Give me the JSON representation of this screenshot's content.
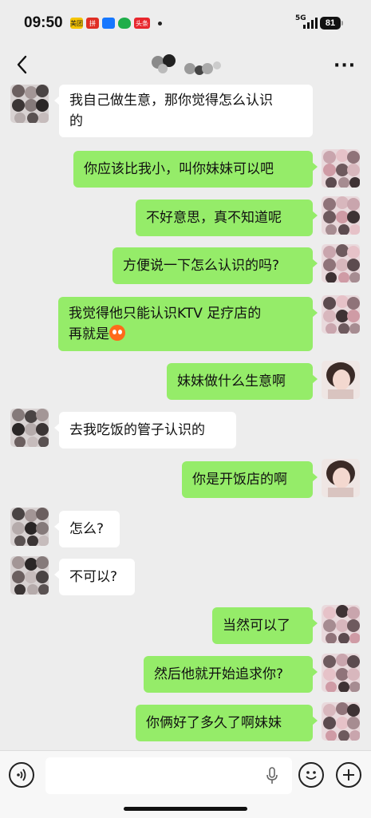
{
  "status_bar": {
    "time": "09:50",
    "app_icons": [
      "美团",
      "拼",
      "",
      "",
      "头条"
    ],
    "network": "5G",
    "battery": "81"
  },
  "header": {
    "back_icon": "chevron-left-icon",
    "more_icon": "ellipsis-icon",
    "more_label": "···"
  },
  "messages": [
    {
      "side": "in",
      "text_line1": "我自己做生意，那你觉得怎么认识",
      "text_line2": "的"
    },
    {
      "side": "out",
      "text": "你应该比我小，叫你妹妹可以吧"
    },
    {
      "side": "out",
      "text": "不好意思，真不知道呢"
    },
    {
      "side": "out",
      "text": "方便说一下怎么认识的吗?"
    },
    {
      "side": "out",
      "text_line1": "我觉得他只能认识KTV   足疗店的",
      "text_line2": "再就是"
    },
    {
      "side": "out",
      "text": "妹妹做什么生意啊"
    },
    {
      "side": "in",
      "text": "去我吃饭的管子认识的"
    },
    {
      "side": "out",
      "text": "你是开饭店的啊"
    },
    {
      "side": "in",
      "text": "怎么?"
    },
    {
      "side": "in",
      "text": "不可以?"
    },
    {
      "side": "out",
      "text": "当然可以了"
    },
    {
      "side": "out",
      "text": "然后他就开始追求你?"
    },
    {
      "side": "out",
      "text": "你俩好了多久了啊妹妹"
    }
  ],
  "input_bar": {
    "voice_icon": "voice-icon",
    "mic_icon": "microphone-icon",
    "emoji_icon": "emoji-icon",
    "plus_icon": "plus-icon",
    "placeholder": ""
  },
  "colors": {
    "outgoing_bubble": "#95ec69",
    "incoming_bubble": "#ffffff",
    "background": "#ededed"
  }
}
